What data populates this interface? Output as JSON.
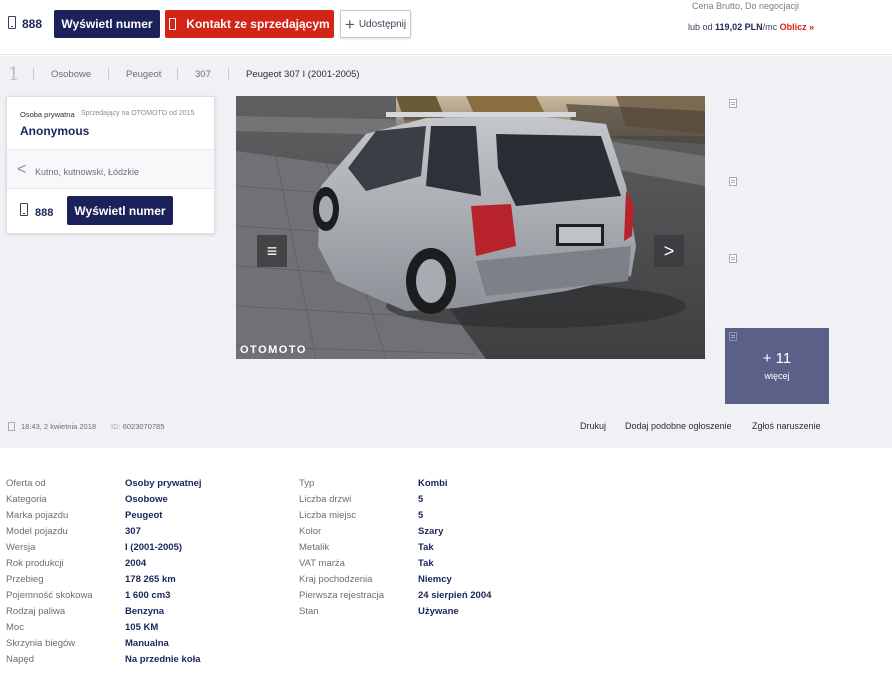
{
  "top": {
    "phone_number": "888",
    "show_number_label": "Wyświetl numer",
    "contact_label": "Kontakt ze sprzedającym",
    "share_label": "Udostępnij",
    "price_note": "Cena Brutto, Do negocjacji",
    "installment_prefix": "lub od",
    "installment_amount": "119,02 PLN",
    "installment_suffix": "/mc",
    "calculate_label": "Oblicz »"
  },
  "breadcrumb": {
    "home": "1",
    "items": [
      "Osobowe",
      "Peugeot",
      "307",
      "Peugeot 307 I (2001-2005)"
    ]
  },
  "seller": {
    "type": "Osoba prywatna",
    "since": "Sprzedający na OTOMOTO od 2015",
    "name": "Anonymous",
    "location": "Kutno, kutnowski, Łódzkie",
    "phone_number": "888",
    "show_number_label": "Wyświetl numer"
  },
  "gallery": {
    "watermark": "OTOMOTO",
    "prev_icon": "≡",
    "next_icon": ">",
    "more_count": "+ 11",
    "more_label": "więcej"
  },
  "meta": {
    "date": "18:43, 2 kwietnia 2018",
    "id_label": "ID:",
    "id_value": "6023070785",
    "print_label": "Drukuj",
    "similar_label": "Dodaj podobne ogłoszenie",
    "report_label": "Zgłoś naruszenie"
  },
  "params_left": [
    {
      "label": "Oferta od",
      "value": "Osoby prywatnej"
    },
    {
      "label": "Kategoria",
      "value": "Osobowe"
    },
    {
      "label": "Marka pojazdu",
      "value": "Peugeot"
    },
    {
      "label": "Model pojazdu",
      "value": "307"
    },
    {
      "label": "Wersja",
      "value": "I (2001-2005)"
    },
    {
      "label": "Rok produkcji",
      "value": "2004"
    },
    {
      "label": "Przebieg",
      "value": "178 265 km"
    },
    {
      "label": "Pojemność skokowa",
      "value": "1 600 cm3"
    },
    {
      "label": "Rodzaj paliwa",
      "value": "Benzyna"
    },
    {
      "label": "Moc",
      "value": "105 KM"
    },
    {
      "label": "Skrzynia biegów",
      "value": "Manualna"
    },
    {
      "label": "Napęd",
      "value": "Na przednie koła"
    }
  ],
  "params_right": [
    {
      "label": "Typ",
      "value": "Kombi"
    },
    {
      "label": "Liczba drzwi",
      "value": "5"
    },
    {
      "label": "Liczba miejsc",
      "value": "5"
    },
    {
      "label": "Kolor",
      "value": "Szary"
    },
    {
      "label": "Metalik",
      "value": "Tak"
    },
    {
      "label": "VAT marża",
      "value": "Tak"
    },
    {
      "label": "Kraj pochodzenia",
      "value": "Niemcy"
    },
    {
      "label": "Pierwsza rejestracja",
      "value": "24 sierpień 2004"
    },
    {
      "label": "Stan",
      "value": "Używane"
    }
  ]
}
